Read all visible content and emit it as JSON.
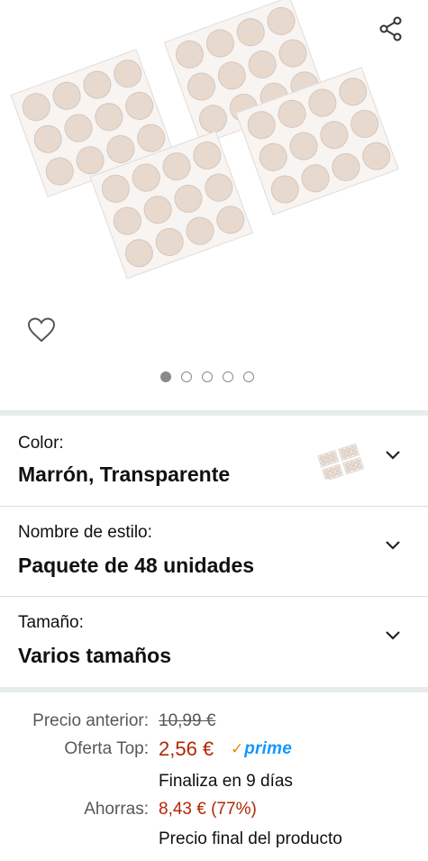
{
  "gallery": {
    "image_alt": "Almohadillas de fieltro para muebles",
    "dot_count": 5,
    "active_dot": 0
  },
  "variations": [
    {
      "label": "Color:",
      "value": "Marrón, Transparente"
    },
    {
      "label": "Nombre de estilo:",
      "value": "Paquete de 48 unidades"
    },
    {
      "label": "Tamaño:",
      "value": "Varios tamaños"
    }
  ],
  "price": {
    "previous_label": "Precio anterior:",
    "previous_value": "10,99 €",
    "deal_label": "Oferta Top:",
    "deal_value": "2,56 €",
    "prime": "prime",
    "ends_text": "Finaliza en 9 días",
    "savings_label": "Ahorras:",
    "savings_value": "8,43 € (77%)",
    "final_text": "Precio final del producto"
  },
  "colors": {
    "pad": "#e8d9cf",
    "deal_price": "#b12704",
    "prime_blue": "#1399ff",
    "prime_check": "#f08804"
  },
  "icons": {
    "share": "share-icon",
    "heart": "heart-icon",
    "chevron": "chevron-down-icon"
  }
}
